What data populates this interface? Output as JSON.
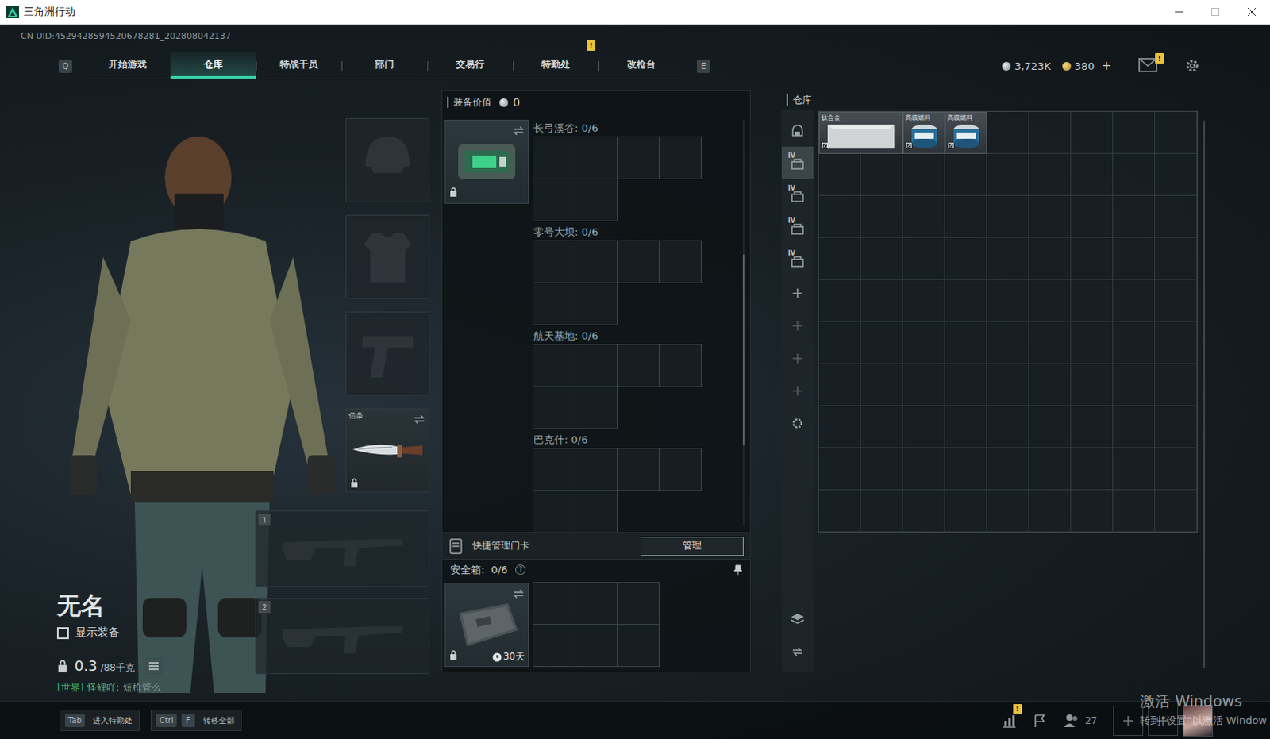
{
  "window": {
    "title": "三角洲行动"
  },
  "uid": "CN UID:4529428594520678281_202808042137",
  "nav": {
    "prev_key": "Q",
    "next_key": "E",
    "tabs": [
      {
        "label": "开始游戏",
        "selected": false
      },
      {
        "label": "仓库",
        "selected": true
      },
      {
        "label": "特战干员",
        "selected": false
      },
      {
        "label": "部门",
        "selected": false
      },
      {
        "label": "交易行",
        "selected": false
      },
      {
        "label": "特勤处",
        "selected": false,
        "badge": "!"
      },
      {
        "label": "改枪台",
        "selected": false
      }
    ]
  },
  "currency": [
    {
      "kind": "silver",
      "amount": "3,723K"
    },
    {
      "kind": "gold",
      "amount": "380",
      "add": "+"
    }
  ],
  "mail": {
    "badge": "!"
  },
  "operator": {
    "name": "无名",
    "show_equipment": {
      "label": "显示装备",
      "checked": false
    },
    "weight": "0.3",
    "weight_limit": "/88千克",
    "chat": {
      "channel": "[世界]",
      "sender": "怪鲤吖:",
      "message": "短枪管么"
    }
  },
  "equipment_slots": [
    {
      "kind": "helmet",
      "filled": false
    },
    {
      "kind": "armor",
      "filled": false
    },
    {
      "kind": "pistol",
      "filled": false
    },
    {
      "kind": "melee",
      "filled": true,
      "label": "信条",
      "locked": true
    }
  ],
  "weapon_slots": [
    {
      "number": "1",
      "filled": false
    },
    {
      "number": "2",
      "filled": false
    }
  ],
  "loadout": {
    "value_label": "装备价值",
    "value": "0",
    "keycard_locked": true,
    "keycard_maps": [
      {
        "name": "长弓溪谷: 0/6"
      },
      {
        "name": "零号大坝: 0/6"
      },
      {
        "name": "航天基地: 0/6"
      },
      {
        "name": "巴克什: 0/6"
      }
    ],
    "quick_manage": {
      "label": "快捷管理门卡",
      "button": "管理"
    },
    "safebox": {
      "label": "安全箱:",
      "count": "0/6",
      "help": "?",
      "duration": "30天",
      "locked": true
    }
  },
  "warehouse": {
    "title": "仓库",
    "sidebar": [
      {
        "kind": "home",
        "selected": false,
        "disabled": false
      },
      {
        "kind": "set",
        "tag": "IV",
        "selected": true,
        "disabled": false
      },
      {
        "kind": "set",
        "tag": "IV",
        "selected": false,
        "disabled": false
      },
      {
        "kind": "set",
        "tag": "IV",
        "selected": false,
        "disabled": false
      },
      {
        "kind": "set",
        "tag": "IV",
        "selected": false,
        "disabled": false
      },
      {
        "kind": "add",
        "selected": false,
        "disabled": false
      },
      {
        "kind": "add",
        "selected": false,
        "disabled": true
      },
      {
        "kind": "add",
        "selected": false,
        "disabled": true
      },
      {
        "kind": "add",
        "selected": false,
        "disabled": true
      },
      {
        "kind": "settings",
        "selected": false,
        "disabled": false
      },
      {
        "kind": "layers",
        "selected": false,
        "disabled": false
      },
      {
        "kind": "transfer",
        "selected": false,
        "disabled": false
      }
    ],
    "items": [
      {
        "name": "钛合金",
        "kind": "plate"
      },
      {
        "name": "高级燃料",
        "kind": "fuel"
      },
      {
        "name": "高级燃料",
        "kind": "fuel"
      }
    ]
  },
  "bottom_bar": {
    "hints": [
      {
        "keys": [
          "Tab"
        ],
        "label": "进入特勤处"
      },
      {
        "keys": [
          "Ctrl",
          "F"
        ],
        "label": "转移全部"
      }
    ],
    "stats_badge": "!",
    "friends": "27"
  },
  "watermark": {
    "title": "激活 Windows",
    "subtitle": "转到“设置”以激活 Window"
  }
}
